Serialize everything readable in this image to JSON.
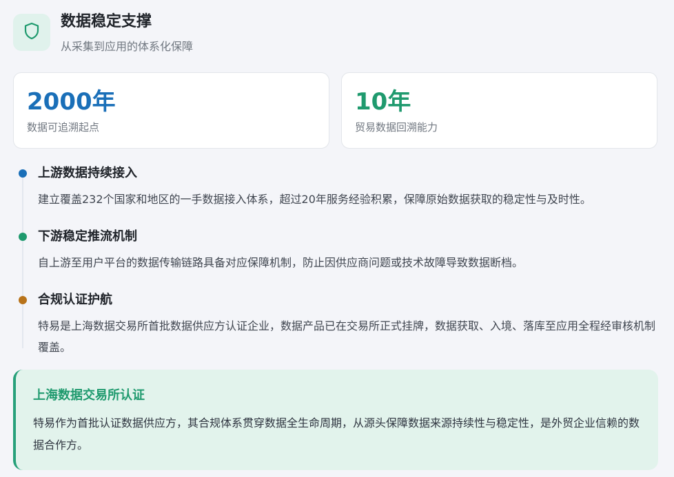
{
  "header": {
    "title": "数据稳定支撑",
    "subtitle": "从采集到应用的体系化保障",
    "icon": "shield-icon"
  },
  "stats": [
    {
      "value": "2000年",
      "label": "数据可追溯起点",
      "color": "#1a6fb8"
    },
    {
      "value": "10年",
      "label": "贸易数据回溯能力",
      "color": "#1f9a6e"
    }
  ],
  "timeline": [
    {
      "title": "上游数据持续接入",
      "description": "建立覆盖232个国家和地区的一手数据接入体系，超过20年服务经验积累，保障原始数据获取的稳定性与及时性。",
      "dot_color": "#1a6fb8"
    },
    {
      "title": "下游稳定推流机制",
      "description": "自上游至用户平台的数据传输链路具备对应保障机制，防止因供应商问题或技术故障导致数据断档。",
      "dot_color": "#1f9a6e"
    },
    {
      "title": "合规认证护航",
      "description": "特易是上海数据交易所首批数据供应方认证企业，数据产品已在交易所正式挂牌，数据获取、入境、落库至应用全程经审核机制覆盖。",
      "dot_color": "#b8731a"
    }
  ],
  "certification": {
    "title": "上海数据交易所认证",
    "description": "特易作为首批认证数据供应方，其合规体系贯穿数据全生命周期，从源头保障数据来源持续性与稳定性，是外贸企业信赖的数据合作方。",
    "accent_color": "#27a07a"
  }
}
